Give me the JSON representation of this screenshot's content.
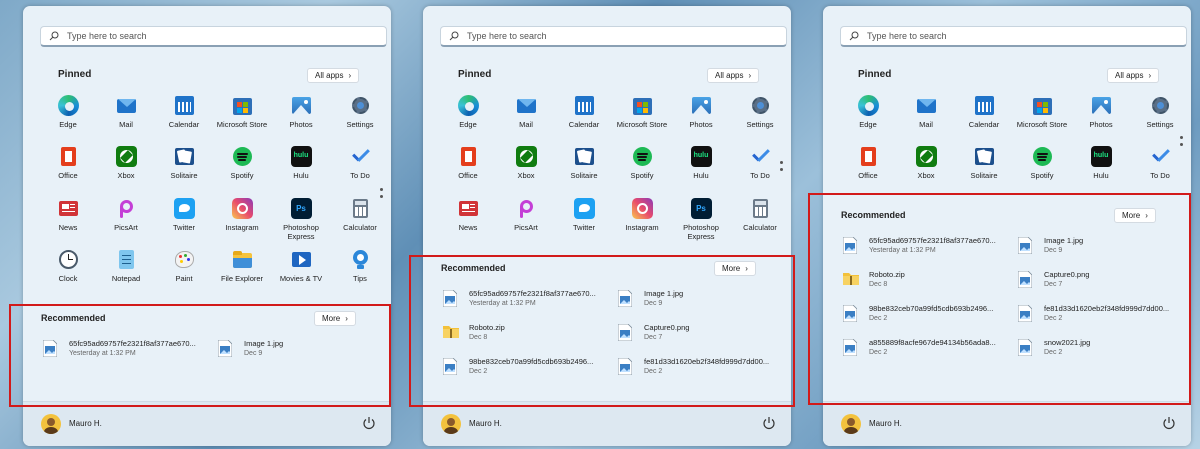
{
  "search": {
    "placeholder": "Type here to search"
  },
  "pinned": {
    "title": "Pinned",
    "all_apps_label": "All apps"
  },
  "apps": [
    {
      "label": "Edge",
      "icon": "edge-icon"
    },
    {
      "label": "Mail",
      "icon": "mail-icon"
    },
    {
      "label": "Calendar",
      "icon": "calendar-icon"
    },
    {
      "label": "Microsoft Store",
      "icon": "store-icon"
    },
    {
      "label": "Photos",
      "icon": "photos-icon"
    },
    {
      "label": "Settings",
      "icon": "settings-icon"
    },
    {
      "label": "Office",
      "icon": "office-icon"
    },
    {
      "label": "Xbox",
      "icon": "xbox-icon"
    },
    {
      "label": "Solitaire",
      "icon": "solitaire-icon"
    },
    {
      "label": "Spotify",
      "icon": "spotify-icon"
    },
    {
      "label": "Hulu",
      "icon": "hulu-icon"
    },
    {
      "label": "To Do",
      "icon": "todo-icon"
    },
    {
      "label": "News",
      "icon": "news-icon"
    },
    {
      "label": "PicsArt",
      "icon": "picsart-icon"
    },
    {
      "label": "Twitter",
      "icon": "twitter-icon"
    },
    {
      "label": "Instagram",
      "icon": "instagram-icon"
    },
    {
      "label": "Photoshop Express",
      "icon": "photoshop-icon"
    },
    {
      "label": "Calculator",
      "icon": "calculator-icon"
    },
    {
      "label": "Clock",
      "icon": "clock-icon"
    },
    {
      "label": "Notepad",
      "icon": "notepad-icon"
    },
    {
      "label": "Paint",
      "icon": "paint-icon"
    },
    {
      "label": "File Explorer",
      "icon": "file-explorer-icon"
    },
    {
      "label": "Movies & TV",
      "icon": "movies-tv-icon"
    },
    {
      "label": "Tips",
      "icon": "tips-icon"
    }
  ],
  "recommended": {
    "title": "Recommended",
    "more_label": "More",
    "items": [
      {
        "name": "65fc95ad69757fe2321f8af377ae670...",
        "time": "Yesterday at 1:32 PM",
        "type": "image"
      },
      {
        "name": "Image 1.jpg",
        "time": "Dec 9",
        "type": "image"
      },
      {
        "name": "Roboto.zip",
        "time": "Dec 8",
        "type": "zip"
      },
      {
        "name": "Capture0.png",
        "time": "Dec 7",
        "type": "image"
      },
      {
        "name": "98be832ceb70a99fd5cdb693b2496...",
        "time": "Dec 2",
        "type": "image"
      },
      {
        "name": "fe81d33d1620eb2f348fd999d7dd00...",
        "time": "Dec 2",
        "type": "image"
      },
      {
        "name": "a855889f8acfe967de94134b56ada8...",
        "time": "Dec 2",
        "type": "image"
      },
      {
        "name": "snow2021.jpg",
        "time": "Dec 2",
        "type": "image"
      }
    ]
  },
  "user": {
    "name": "Mauro H."
  },
  "colors": {
    "highlight_box": "#d21a1a",
    "panel_bg": "#e8f1f8"
  }
}
